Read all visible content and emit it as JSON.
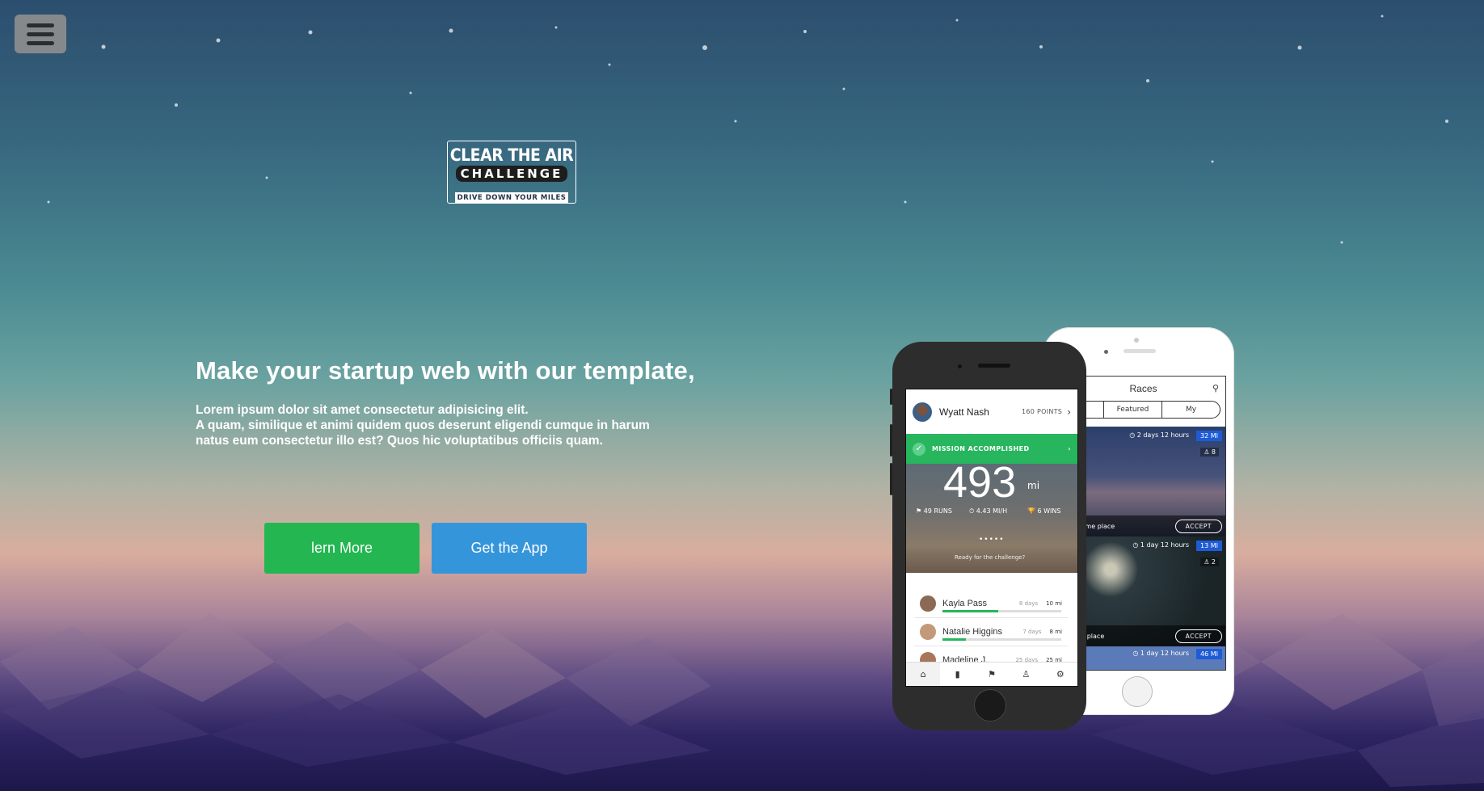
{
  "hero": {
    "title": "Make your startup web with our template,",
    "line1": "Lorem ipsum dolor sit amet consectetur adipisicing elit.",
    "line2": "A quam, similique et animi quidem quos deserunt eligendi cumque in harum",
    "line3": "natus eum consectetur illo est? Quos hic voluptatibus officiis quam."
  },
  "logo": {
    "line1": "CLEAR THE AIR",
    "line2": "CHALLENGE",
    "tagline": "DRIVE DOWN YOUR MILES"
  },
  "buttons": {
    "learn_more": "lern More",
    "get_app": "Get the App"
  },
  "colors": {
    "learn_more_bg": "#23b651",
    "get_app_bg": "#3595db"
  },
  "phone_black": {
    "user_name": "Wyatt Nash",
    "points": "160 POINTS",
    "mission": "MISSION ACCOMPLISHED",
    "big_number": "493",
    "big_unit": "mi",
    "runs": "49 RUNS",
    "speed": "4.43 MI/H",
    "wins": "6 WINS",
    "ready": "Ready for the challenge?",
    "list": [
      {
        "name": "Kayla Pass",
        "days": "8 days",
        "miles": "10 mi",
        "progress": 0.47,
        "color": "#27b65e"
      },
      {
        "name": "Natalie Higgins",
        "days": "7 days",
        "miles": "8 mi",
        "progress": 0.2,
        "color": "#27b65e"
      },
      {
        "name": "Madeline J.",
        "days": "25 days",
        "miles": "25 mi",
        "progress": 0.65,
        "color": "#1e5bd6"
      }
    ]
  },
  "phone_white": {
    "title": "Races",
    "tabs": [
      "ent",
      "Featured",
      "My"
    ],
    "races": [
      {
        "time": "2 days 12 hours",
        "miles": "32 MI",
        "people": "8",
        "name": "awesome place",
        "accept": "ACCEPT"
      },
      {
        "time": "1 day 12 hours",
        "miles": "13 MI",
        "people": "2",
        "name": "winter place",
        "accept": "ACCEPT"
      },
      {
        "time": "1 day 12 hours",
        "miles": "46 MI"
      }
    ]
  }
}
